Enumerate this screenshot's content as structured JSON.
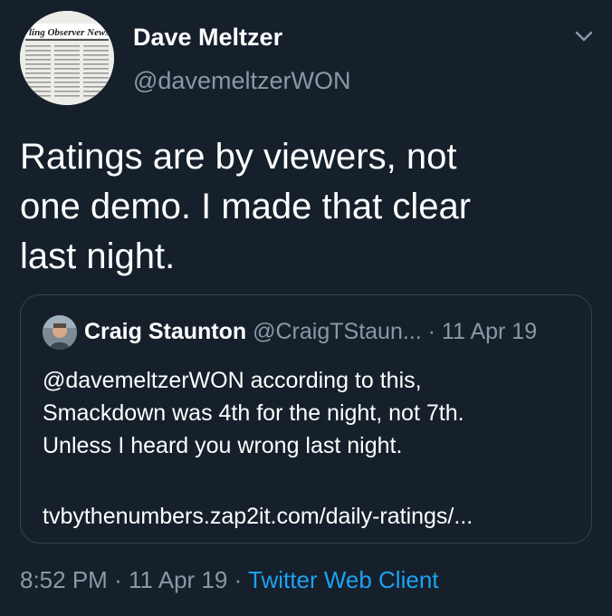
{
  "author": {
    "display_name": "Dave Meltzer",
    "handle": "@davemeltzerWON",
    "avatar": "wrestling-observer-newsletter-avatar",
    "avatar_text": "Wrestling Observer Newsletter"
  },
  "tweet": {
    "text": "Ratings are by viewers, not\none demo.  I made that clear\nlast night."
  },
  "quoted_tweet": {
    "display_name": "Craig Staunton",
    "handle": "@CraigTStaun...",
    "separator": "·",
    "date": "11 Apr 19",
    "text": "@davemeltzerWON according to this,\nSmackdown was 4th for the night, not 7th.\nUnless I heard you wrong last night.",
    "link": "tvbythenumbers.zap2it.com/daily-ratings/..."
  },
  "meta": {
    "time": "8:52 PM",
    "sep1": "·",
    "date": "11 Apr 19",
    "sep2": "·",
    "source": "Twitter Web Client"
  },
  "icons": {
    "more": "chevron-down-icon"
  },
  "colors": {
    "background": "#15202b",
    "text": "#ffffff",
    "secondary": "#8899a6",
    "link": "#1da1f2",
    "border": "#38444d"
  }
}
